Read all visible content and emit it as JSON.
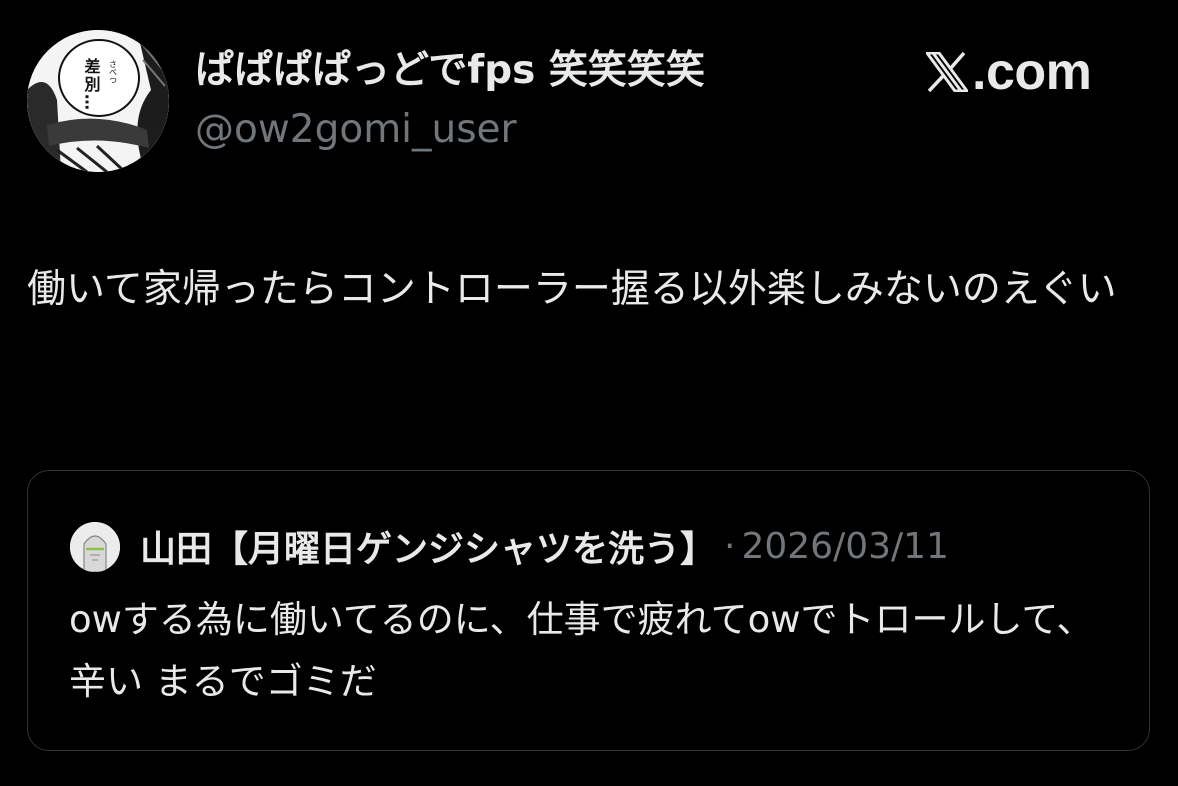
{
  "tweet": {
    "author": {
      "display_name": "ぱぱぱぱっどでfps 笑笑笑笑",
      "handle": "@ow2gomi_user",
      "avatar_icon": "manga-avatar-icon",
      "avatar_text": "差別…",
      "avatar_furigana": "さべつ"
    },
    "brand": {
      "logo_icon": "x-logo-icon",
      "text": ".com"
    },
    "text": "働いて家帰ったらコントローラー握る以外楽しみないのえぐい",
    "quote": {
      "avatar_icon": "genji-avatar-icon",
      "author_name": "山田【月曜日ゲンジシャツを洗う】",
      "separator": "·",
      "date": "2026/03/11",
      "text": "owする為に働いてるのに、仕事で疲れてowでトロールして、辛い まるでゴミだ"
    }
  },
  "colors": {
    "background": "#000000",
    "text_primary": "#e7e9ea",
    "text_secondary": "#71767b",
    "border": "#2f3336"
  }
}
